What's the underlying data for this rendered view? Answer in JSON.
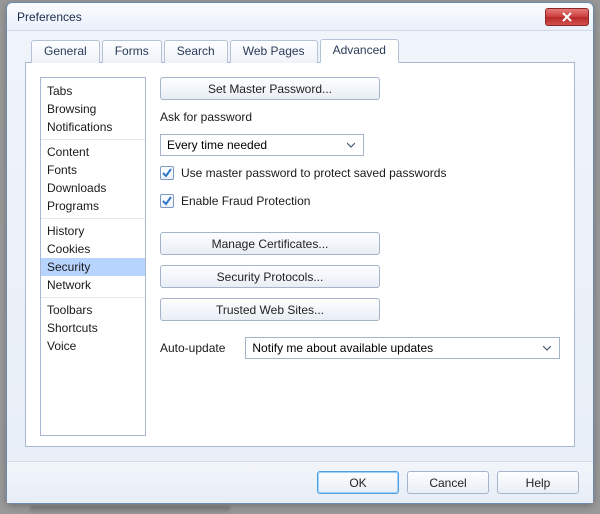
{
  "window": {
    "title": "Preferences"
  },
  "tabs": [
    "General",
    "Forms",
    "Search",
    "Web Pages",
    "Advanced"
  ],
  "activeTab": 4,
  "sidebar": {
    "groups": [
      [
        "Tabs",
        "Browsing",
        "Notifications"
      ],
      [
        "Content",
        "Fonts",
        "Downloads",
        "Programs"
      ],
      [
        "History",
        "Cookies",
        "Security",
        "Network"
      ],
      [
        "Toolbars",
        "Shortcuts",
        "Voice"
      ]
    ],
    "selected": "Security"
  },
  "main": {
    "setMasterPassword": "Set Master Password...",
    "askForPassword": "Ask for password",
    "askForPasswordValue": "Every time needed",
    "useMasterPw": "Use master password to protect saved passwords",
    "useMasterPwChecked": true,
    "enableFraud": "Enable Fraud Protection",
    "enableFraudChecked": true,
    "manageCerts": "Manage Certificates...",
    "secProtocols": "Security Protocols...",
    "trustedSites": "Trusted Web Sites...",
    "autoUpdateLabel": "Auto-update",
    "autoUpdateValue": "Notify me about available updates"
  },
  "buttons": {
    "ok": "OK",
    "cancel": "Cancel",
    "help": "Help"
  }
}
